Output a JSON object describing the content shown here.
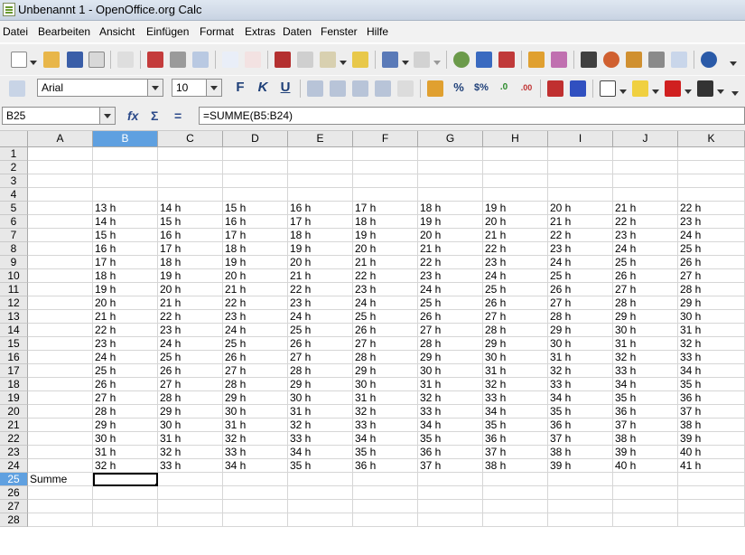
{
  "window": {
    "title": "Unbenannt 1 - OpenOffice.org Calc"
  },
  "menu": [
    "Datei",
    "Bearbeiten",
    "Ansicht",
    "Einfügen",
    "Format",
    "Extras",
    "Daten",
    "Fenster",
    "Hilfe"
  ],
  "toolbar": {
    "font_name": "Arial",
    "font_size": "10",
    "bold_label": "F",
    "italic_label": "K",
    "underline_label": "U",
    "percent_label": "%",
    "currency_label": "$%",
    "decimal_add_label": ".0",
    "decimal_del_label": ".00"
  },
  "formula_bar": {
    "name_box": "B25",
    "fx_label": "fx",
    "sum_label": "Σ",
    "equals_label": "=",
    "formula": "=SUMME(B5:B24)"
  },
  "sheet": {
    "columns": [
      "A",
      "B",
      "C",
      "D",
      "E",
      "F",
      "G",
      "H",
      "I",
      "J",
      "K"
    ],
    "selected_column": "B",
    "rows": [
      "1",
      "2",
      "3",
      "4",
      "5",
      "6",
      "7",
      "8",
      "9",
      "10",
      "11",
      "12",
      "13",
      "14",
      "15",
      "16",
      "17",
      "18",
      "19",
      "20",
      "21",
      "22",
      "23",
      "24",
      "25",
      "26",
      "27",
      "28"
    ],
    "selected_row": "25",
    "data_rows": [
      [
        "13 h",
        "14 h",
        "15 h",
        "16 h",
        "17 h",
        "18 h",
        "19 h",
        "20 h",
        "21 h",
        "22 h"
      ],
      [
        "14 h",
        "15 h",
        "16 h",
        "17 h",
        "18 h",
        "19 h",
        "20 h",
        "21 h",
        "22 h",
        "23 h"
      ],
      [
        "15 h",
        "16 h",
        "17 h",
        "18 h",
        "19 h",
        "20 h",
        "21 h",
        "22 h",
        "23 h",
        "24 h"
      ],
      [
        "16 h",
        "17 h",
        "18 h",
        "19 h",
        "20 h",
        "21 h",
        "22 h",
        "23 h",
        "24 h",
        "25 h"
      ],
      [
        "17 h",
        "18 h",
        "19 h",
        "20 h",
        "21 h",
        "22 h",
        "23 h",
        "24 h",
        "25 h",
        "26 h"
      ],
      [
        "18 h",
        "19 h",
        "20 h",
        "21 h",
        "22 h",
        "23 h",
        "24 h",
        "25 h",
        "26 h",
        "27 h"
      ],
      [
        "19 h",
        "20 h",
        "21 h",
        "22 h",
        "23 h",
        "24 h",
        "25 h",
        "26 h",
        "27 h",
        "28 h"
      ],
      [
        "20 h",
        "21 h",
        "22 h",
        "23 h",
        "24 h",
        "25 h",
        "26 h",
        "27 h",
        "28 h",
        "29 h"
      ],
      [
        "21 h",
        "22 h",
        "23 h",
        "24 h",
        "25 h",
        "26 h",
        "27 h",
        "28 h",
        "29 h",
        "30 h"
      ],
      [
        "22 h",
        "23 h",
        "24 h",
        "25 h",
        "26 h",
        "27 h",
        "28 h",
        "29 h",
        "30 h",
        "31 h"
      ],
      [
        "23 h",
        "24 h",
        "25 h",
        "26 h",
        "27 h",
        "28 h",
        "29 h",
        "30 h",
        "31 h",
        "32 h"
      ],
      [
        "24 h",
        "25 h",
        "26 h",
        "27 h",
        "28 h",
        "29 h",
        "30 h",
        "31 h",
        "32 h",
        "33 h"
      ],
      [
        "25 h",
        "26 h",
        "27 h",
        "28 h",
        "29 h",
        "30 h",
        "31 h",
        "32 h",
        "33 h",
        "34 h"
      ],
      [
        "26 h",
        "27 h",
        "28 h",
        "29 h",
        "30 h",
        "31 h",
        "32 h",
        "33 h",
        "34 h",
        "35 h"
      ],
      [
        "27 h",
        "28 h",
        "29 h",
        "30 h",
        "31 h",
        "32 h",
        "33 h",
        "34 h",
        "35 h",
        "36 h"
      ],
      [
        "28 h",
        "29 h",
        "30 h",
        "31 h",
        "32 h",
        "33 h",
        "34 h",
        "35 h",
        "36 h",
        "37 h"
      ],
      [
        "29 h",
        "30 h",
        "31 h",
        "32 h",
        "33 h",
        "34 h",
        "35 h",
        "36 h",
        "37 h",
        "38 h"
      ],
      [
        "30 h",
        "31 h",
        "32 h",
        "33 h",
        "34 h",
        "35 h",
        "36 h",
        "37 h",
        "38 h",
        "39 h"
      ],
      [
        "31 h",
        "32 h",
        "33 h",
        "34 h",
        "35 h",
        "36 h",
        "37 h",
        "38 h",
        "39 h",
        "40 h"
      ],
      [
        "32 h",
        "33 h",
        "34 h",
        "35 h",
        "36 h",
        "37 h",
        "38 h",
        "39 h",
        "40 h",
        "41 h"
      ]
    ],
    "sum_label": "Summe"
  }
}
